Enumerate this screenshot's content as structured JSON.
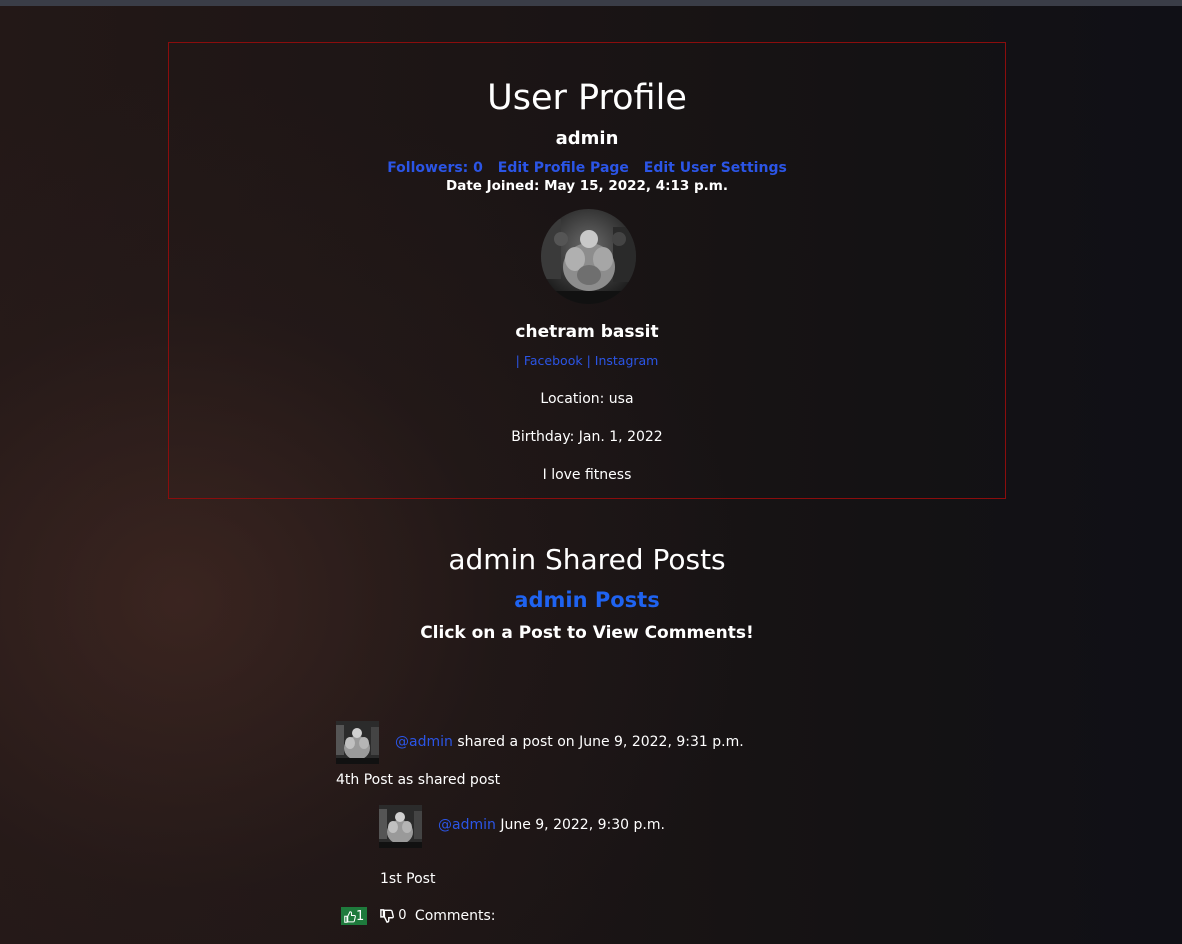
{
  "profile": {
    "title": "User Profile",
    "username": "admin",
    "followers_label": "Followers: 0",
    "edit_profile_label": "Edit Profile Page",
    "edit_settings_label": "Edit User Settings",
    "date_joined": "Date Joined: May 15, 2022, 4:13 p.m.",
    "display_name": "chetram bassit",
    "social": {
      "separator": "|",
      "facebook": "Facebook",
      "instagram": "Instagram"
    },
    "location": "Location: usa",
    "birthday": "Birthday: Jan. 1, 2022",
    "bio": "I love fitness"
  },
  "shared": {
    "title": "admin Shared Posts",
    "posts_link": "admin Posts",
    "hint": "Click on a Post to View Comments!"
  },
  "post": {
    "author_handle": "@admin",
    "shared_text": "shared a post on June 9, 2022, 9:31 p.m.",
    "body": "4th Post as shared post",
    "original": {
      "author_handle": "@admin",
      "timestamp": "June 9, 2022, 9:30 p.m.",
      "body": "1st Post"
    },
    "likes": "1",
    "dislikes": "0",
    "comments_label": "Comments:"
  },
  "colors": {
    "link": "#2b55e6",
    "posts_link": "#1f63f0",
    "border": "#8a0d0d",
    "like_bg": "#1e7a3c"
  },
  "icons": {
    "like": "thumbs-up-icon",
    "dislike": "thumbs-down-icon"
  }
}
